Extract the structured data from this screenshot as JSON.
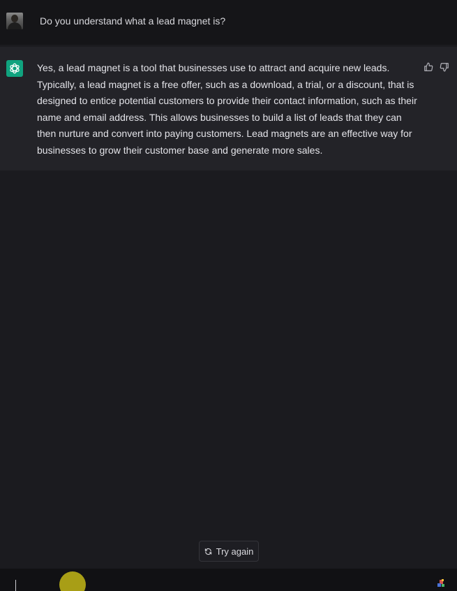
{
  "conversation": {
    "user_message": "Do you understand what a lead magnet is?",
    "assistant_message": "Yes, a lead magnet is a tool that businesses use to attract and acquire new leads. Typically, a lead magnet is a free offer, such as a download, a trial, or a discount, that is designed to entice potential customers to provide their contact information, such as their name and email address. This allows businesses to build a list of leads that they can then nurture and convert into paying customers. Lead magnets are an effective way for businesses to grow their customer base and generate more sales."
  },
  "actions": {
    "try_again_label": "Try again"
  },
  "icons": {
    "assistant_logo": "openai-logo-icon",
    "user_avatar": "user-avatar",
    "thumbs_up": "thumbs-up-icon",
    "thumbs_down": "thumbs-down-icon",
    "regenerate": "refresh-icon"
  },
  "colors": {
    "background": "#1b1b1f",
    "assistant_row": "#232328",
    "brand": "#10a37f",
    "cursor_highlight": "#b9ae16"
  }
}
